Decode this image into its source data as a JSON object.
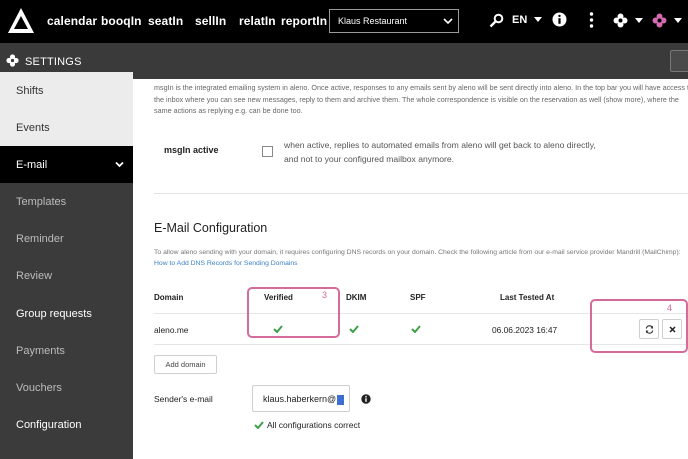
{
  "topbar": {
    "nav": [
      "calendar",
      "booqIn",
      "seatIn",
      "sellIn",
      "relatIn",
      "reportIn"
    ],
    "restaurant": "Klaus Restaurant",
    "language": "EN",
    "icons": [
      "search-icon",
      "info-icon",
      "more-vertical-icon",
      "flower-icon",
      "flower-pink-icon"
    ],
    "accent": "#d56bb2"
  },
  "settings_bar": {
    "label": "SETTINGS"
  },
  "sidebar": {
    "items": [
      {
        "label": "Shifts",
        "state": "light"
      },
      {
        "label": "Events",
        "state": "light"
      },
      {
        "label": "E-mail",
        "state": "active"
      },
      {
        "label": "Templates",
        "state": "dark"
      },
      {
        "label": "Reminder",
        "state": "dark"
      },
      {
        "label": "Review",
        "state": "dark"
      },
      {
        "label": "Group requests",
        "state": "dark-white"
      },
      {
        "label": "Payments",
        "state": "dark"
      },
      {
        "label": "Vouchers",
        "state": "dark"
      },
      {
        "label": "Configuration",
        "state": "dark-white"
      }
    ]
  },
  "msgin": {
    "intro": "msgIn is the integrated emailing system in aleno. Once active, responses to any emails sent by aleno will be sent directly into aleno. In the top bar you will have access to the inbox where you can see new messages, reply to them and archive them. The whole correspondence is visible on the reservation as well (show more), where the same actions as replying e.g. can be done too.",
    "label": "msgIn active",
    "description": "when active, replies to automated emails from aleno will get back to aleno directly, and not to your configured mailbox anymore."
  },
  "email_config": {
    "title": "E-Mail Configuration",
    "description": "To allow aleno sending with your domain, it requires configuring DNS records on your domain. Check the following article from our e-mail service provider Mandrill (MailChimp):",
    "link": "How to Add DNS Records for Sending Domains",
    "columns": [
      "Domain",
      "Verified",
      "DKIM",
      "SPF",
      "Last Tested At"
    ],
    "rows": [
      {
        "domain": "aleno.me",
        "verified": true,
        "dkim": true,
        "spf": true,
        "last_tested": "06.06.2023 16:47"
      }
    ],
    "add_domain": "Add domain",
    "annotations": [
      "3",
      "4"
    ],
    "sender_label": "Sender's e-mail",
    "sender_value": "klaus.haberkern@",
    "status": "All configurations correct",
    "ok_color": "#3fa04a"
  }
}
